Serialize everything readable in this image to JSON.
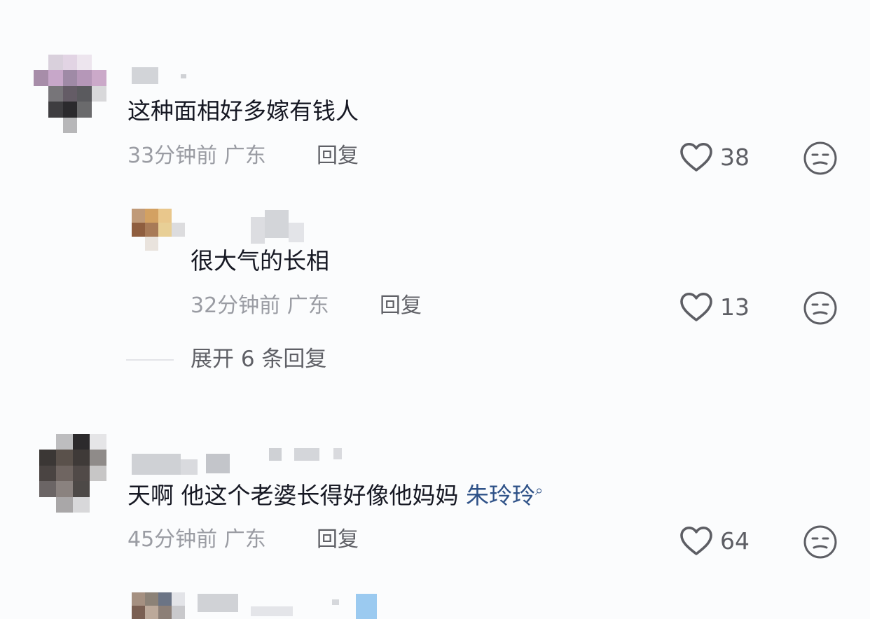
{
  "comments": [
    {
      "text": "这种面相好多嫁有钱人",
      "time": "33分钟前",
      "location": "广东",
      "reply_label": "回复",
      "likes": "38"
    },
    {
      "text": "很大气的长相",
      "time": "32分钟前",
      "location": "广东",
      "reply_label": "回复",
      "likes": "13"
    },
    {
      "text": "天啊 他这个老婆长得好像他妈妈",
      "mention": "朱玲玲",
      "time": "45分钟前",
      "location": "广东",
      "reply_label": "回复",
      "likes": "64"
    }
  ],
  "expand_replies": "展开 6 条回复",
  "colors": {
    "background": "#fbfcfd",
    "text": "#161823",
    "meta": "#9a9ca3",
    "mention": "#2f5288"
  },
  "icons": [
    "heart-outline-icon",
    "unamused-emoji-icon",
    "search-icon"
  ]
}
